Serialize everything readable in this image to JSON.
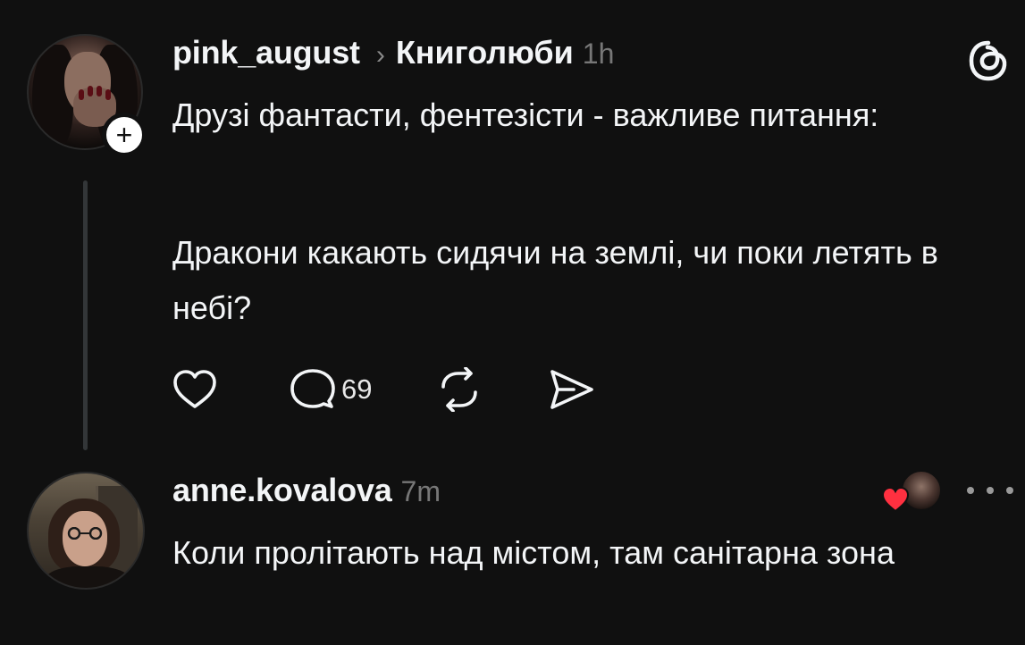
{
  "post": {
    "username": "pink_august",
    "separator": "›",
    "community": "Книголюби",
    "time": "1h",
    "paragraph1": "Друзі фантасти, фентезісти - важливе питання:",
    "paragraph2": "Дракони какають сидячи на землі, чи поки летять в небі?",
    "actions": {
      "like_icon": "heart-outline-icon",
      "comment_icon": "comment-bubble-icon",
      "comment_count": "69",
      "repost_icon": "repost-arrows-icon",
      "share_icon": "send-paper-plane-icon"
    },
    "follow_icon": "plus-icon"
  },
  "app": {
    "logo_icon": "threads-logo-icon"
  },
  "reply": {
    "username": "anne.kovalova",
    "time": "7m",
    "text": "Коли пролітають над містом, там санітарна зона",
    "liked_by_icon": "red-heart-icon",
    "more_icon": "more-dots-icon"
  },
  "colors": {
    "background": "#101010",
    "text": "#f3f5f7",
    "muted": "#777777",
    "heart": "#ff3040"
  }
}
